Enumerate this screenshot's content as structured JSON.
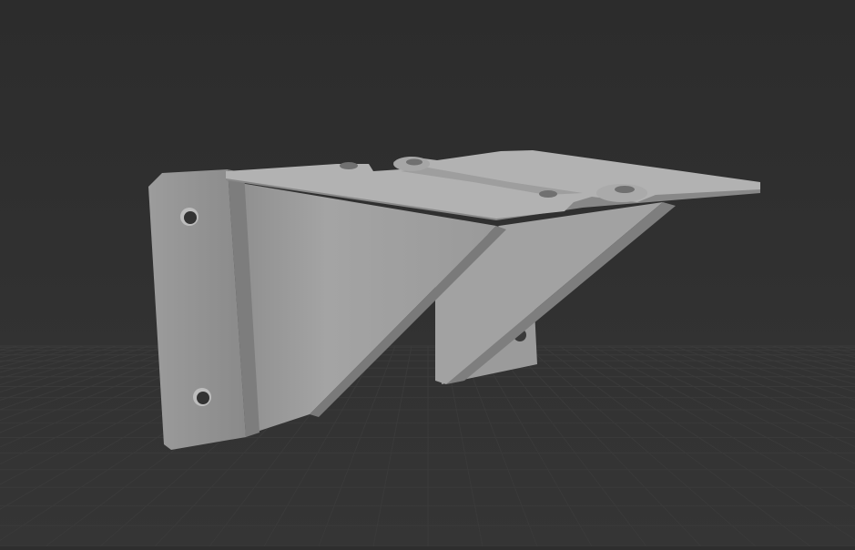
{
  "viewport": {
    "background_color": "#2e2e2e",
    "grid_color": "#3a3a3a",
    "model_color": "#a9a9a9"
  }
}
